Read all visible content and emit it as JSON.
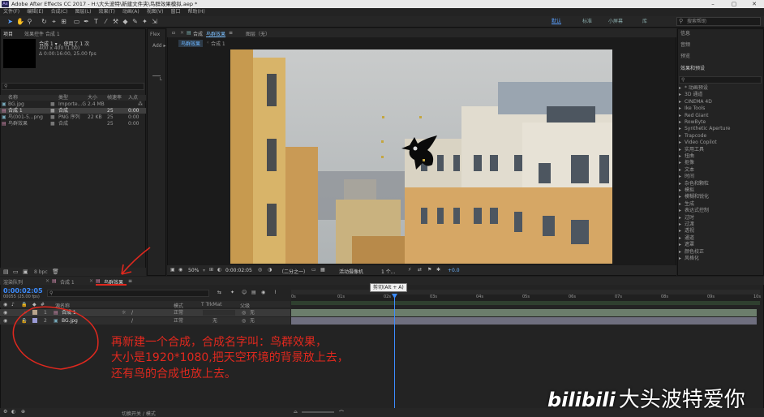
{
  "title": "Adobe After Effects CC 2017 - H:\\大头波特\\新建文件夹\\鸟群效果模拟.aep *",
  "app_icon_text": "Ae",
  "menu": [
    "文件(F)",
    "编辑(E)",
    "合成(C)",
    "图层(L)",
    "效果(T)",
    "动画(A)",
    "视图(V)",
    "窗口",
    "帮助(H)"
  ],
  "workspaces": [
    "默认",
    "标准",
    "小屏幕",
    "库"
  ],
  "search_placeholder": "搜索帮助",
  "project": {
    "tab": "项目",
    "effects_tab": "效果控件 合成 1",
    "comp_name": "合成 1 ▾ ，使用了 1 次",
    "comp_info1": "400 x 400 (1.00)",
    "comp_info2": "Δ 0:00:16:00, 25.00 fps",
    "columns": [
      "名称",
      "类型",
      "大小",
      "帧速率",
      "入点"
    ],
    "items": [
      {
        "name": "BG.jpg",
        "type": "Importe...G",
        "size": "2.4 MB",
        "fps": "",
        "in": ""
      },
      {
        "name": "合成 1",
        "type": "合成",
        "size": "",
        "fps": "25",
        "in": "0:00"
      },
      {
        "name": "鸟(001-5...png",
        "type": "PNG 序列",
        "size": "22 KB",
        "fps": "25",
        "in": "0:00"
      },
      {
        "name": "鸟群效果",
        "type": "合成",
        "size": "",
        "fps": "25",
        "in": "0:00"
      }
    ],
    "bpc": "8 bpc"
  },
  "flex": "Flex",
  "add": "Add ▸",
  "viewer": {
    "tab1": "合成",
    "tab1_name": "鸟群效果",
    "layer_tab": "图层（无）",
    "subtabs": [
      "鸟群效果",
      "合成 1"
    ],
    "zoom": "50%",
    "timecode": "0:00:02:05",
    "resolution": "（二分之一）",
    "camera": "活动摄像机",
    "views": "1 个...",
    "offset": "+0.0"
  },
  "right_panels": {
    "info": "信息",
    "audio": "音频",
    "preview": "预览",
    "effects": "效果和预设",
    "effects_list": [
      "* 动画预设",
      "3D 通道",
      "CINEMA 4D",
      "Ike Tools",
      "Red Giant",
      "RowByte",
      "Synthetic Aperture",
      "Trapcode",
      "Video Copilot",
      "实用工具",
      "扭曲",
      "抠像",
      "文本",
      "时间",
      "杂色和颗粒",
      "模拟",
      "模糊和锐化",
      "生成",
      "表达式控制",
      "过时",
      "过渡",
      "透视",
      "通道",
      "遮罩",
      "颜色校正",
      "风格化"
    ]
  },
  "timeline": {
    "tabs": [
      "渲染队列",
      "合成 1",
      "鸟群效果"
    ],
    "timecode": "0:00:02:05",
    "frames": "00055 (25.00 fps)",
    "columns": [
      "源名称",
      "模式",
      "T TrkMat",
      "父级"
    ],
    "layers": [
      {
        "num": "1",
        "name": "合成 1",
        "mode": "正常",
        "trk": "",
        "parent": "无"
      },
      {
        "num": "2",
        "name": "BG.jpg",
        "mode": "正常",
        "trk": "无",
        "parent": "无"
      }
    ],
    "ticks": [
      "0s",
      "01s",
      "02s",
      "03s",
      "04s",
      "05s",
      "06s",
      "07s",
      "08s",
      "09s",
      "10s"
    ],
    "tooltip": "剪切(Alt + A)",
    "bottom_btn": "切换开关 / 模式"
  },
  "annotation": [
    "再新建一个合成，合成名字叫：鸟群效果，",
    "大小是1920*1080,把天空环境的背景放上去，",
    "还有鸟的合成也放上去。"
  ],
  "watermark": "bilibili 大头波特爱你",
  "watermark_logo": "bilibili",
  "watermark_text": "大头波特爱你",
  "colors": {
    "accent": "#2d8ceb",
    "annotation": "#e0281e"
  }
}
